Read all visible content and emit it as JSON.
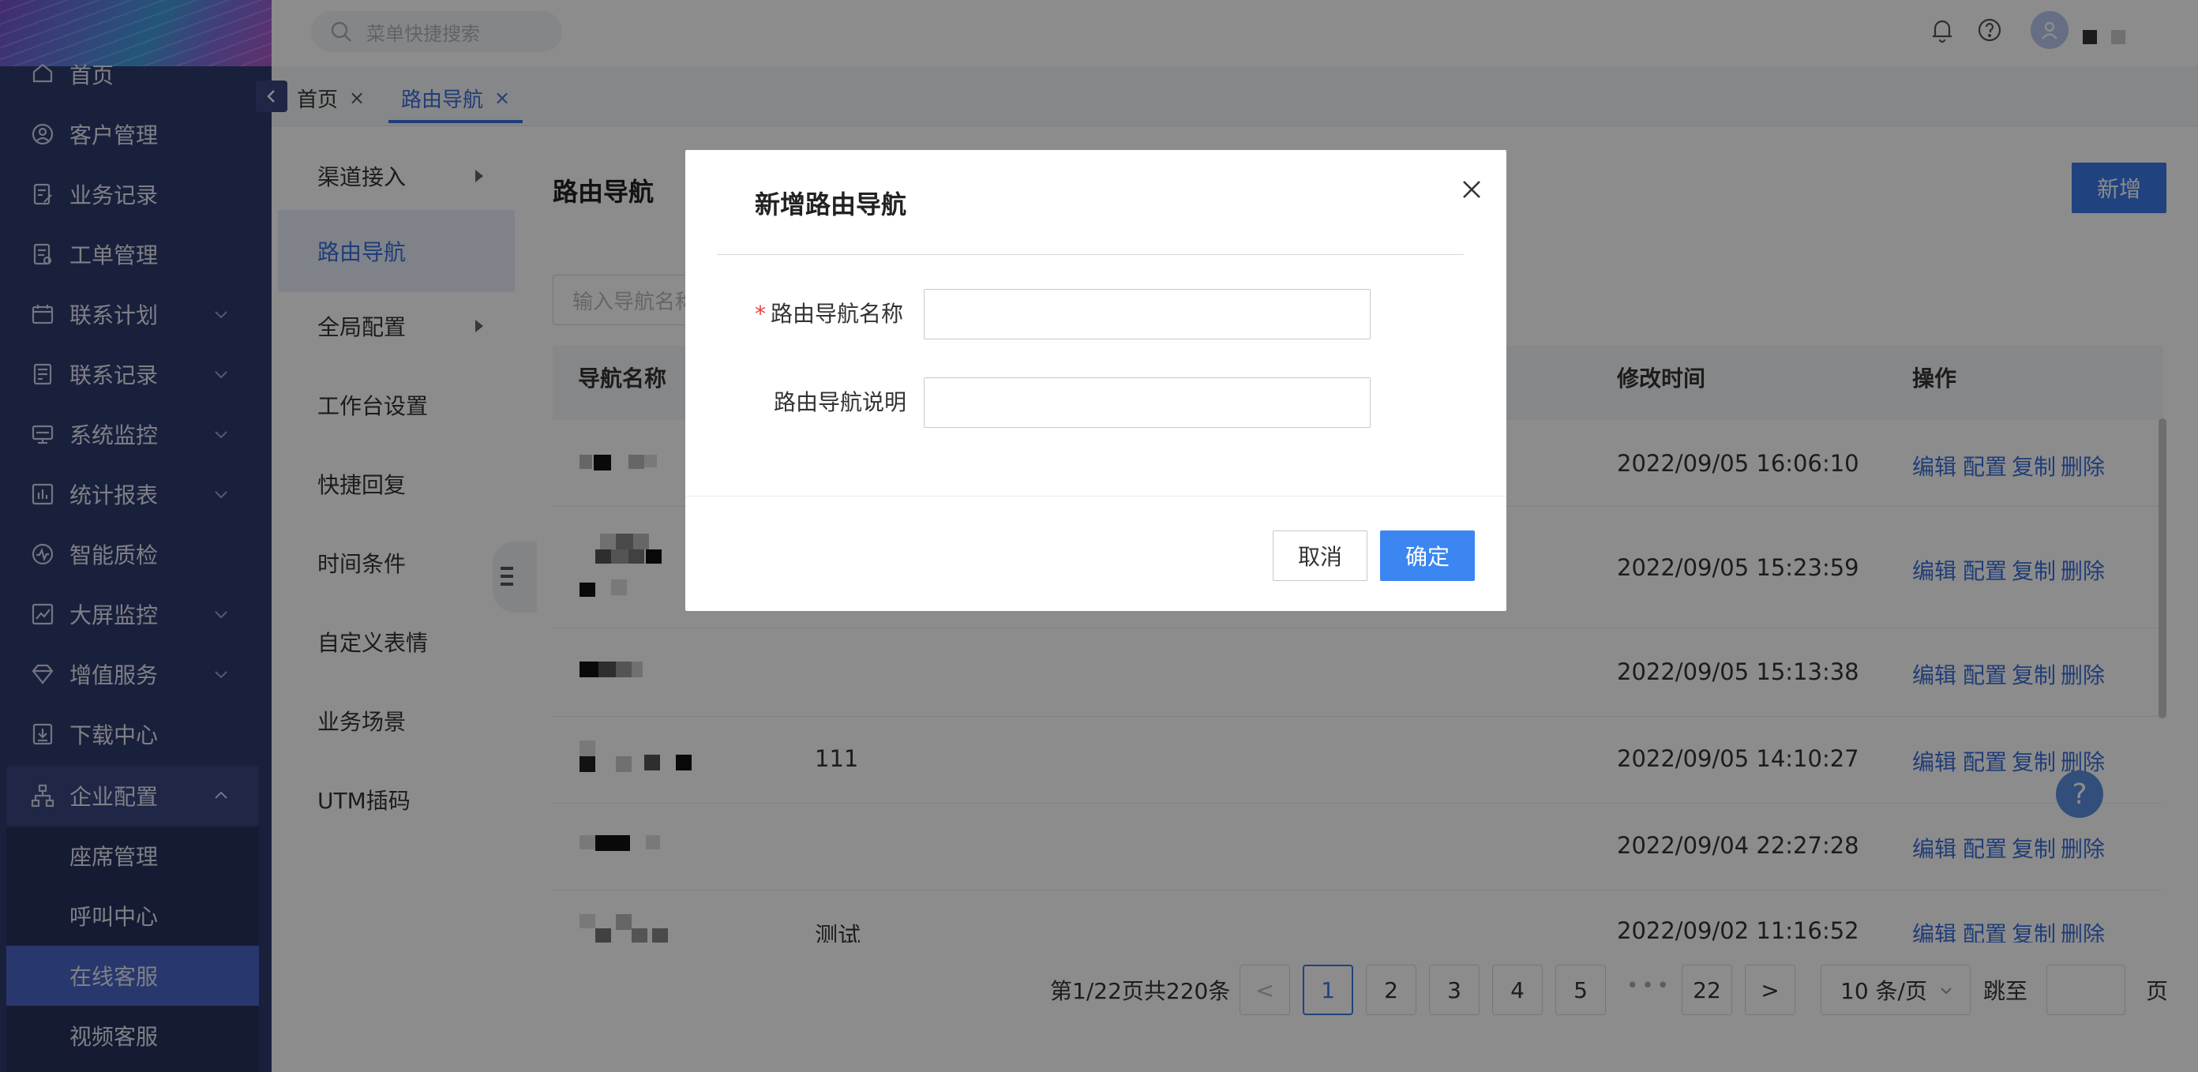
{
  "search": {
    "placeholder": "菜单快捷搜索"
  },
  "sidebar": {
    "items": [
      {
        "label": "首页",
        "icon": "home-icon"
      },
      {
        "label": "客户管理",
        "icon": "user-circle-icon"
      },
      {
        "label": "业务记录",
        "icon": "document-edit-icon"
      },
      {
        "label": "工单管理",
        "icon": "ticket-icon"
      },
      {
        "label": "联系计划",
        "icon": "calendar-icon"
      },
      {
        "label": "联系记录",
        "icon": "record-icon"
      },
      {
        "label": "系统监控",
        "icon": "monitor-icon"
      },
      {
        "label": "统计报表",
        "icon": "bar-chart-icon"
      },
      {
        "label": "智能质检",
        "icon": "quality-check-icon"
      },
      {
        "label": "大屏监控",
        "icon": "trend-chart-icon"
      },
      {
        "label": "增值服务",
        "icon": "diamond-icon"
      },
      {
        "label": "下载中心",
        "icon": "download-icon"
      },
      {
        "label": "企业配置",
        "icon": "org-chart-icon"
      }
    ],
    "subitems": [
      {
        "label": "座席管理"
      },
      {
        "label": "呼叫中心"
      },
      {
        "label": "在线客服"
      },
      {
        "label": "视频客服"
      }
    ]
  },
  "tabs": [
    {
      "label": "首页",
      "close": "×"
    },
    {
      "label": "路由导航",
      "close": "×"
    }
  ],
  "submenu": {
    "items": [
      {
        "label": "渠道接入"
      },
      {
        "label": "路由导航"
      },
      {
        "label": "全局配置"
      },
      {
        "label": "工作台设置"
      },
      {
        "label": "快捷回复"
      },
      {
        "label": "时间条件"
      },
      {
        "label": "自定义表情"
      },
      {
        "label": "业务场景"
      },
      {
        "label": "UTM插码"
      }
    ]
  },
  "main": {
    "title": "路由导航",
    "add_label": "新增",
    "filter_placeholder": "输入导航名称",
    "columns": {
      "name": "导航名称",
      "modified": "修改时间",
      "actions": "操作"
    },
    "actions": {
      "edit": "编辑",
      "config": "配置",
      "copy": "复制",
      "delete": "删除"
    },
    "rows": [
      {
        "desc": "",
        "time": "2022/09/05 16:06:10"
      },
      {
        "desc": "",
        "time": "2022/09/05 15:23:59"
      },
      {
        "desc": "",
        "time": "2022/09/05 15:13:38"
      },
      {
        "desc": "111",
        "time": "2022/09/05 14:10:27"
      },
      {
        "desc": "",
        "time": "2022/09/04 22:27:28"
      },
      {
        "desc": "测试",
        "time": "2022/09/02 11:16:52"
      }
    ]
  },
  "pagination": {
    "summary": "第1/22页共220条",
    "prev": "<",
    "pages": [
      "1",
      "2",
      "3",
      "4",
      "5"
    ],
    "dots": "•••",
    "last": "22",
    "next": ">",
    "page_size": "10 条/页",
    "jump_label": "跳至",
    "page_suffix": "页"
  },
  "help": {
    "label": "?"
  },
  "modal": {
    "title": "新增路由导航",
    "required_mark": "*",
    "name_label": "路由导航名称",
    "name_value": "",
    "desc_label": "路由导航说明",
    "desc_value": "",
    "cancel_label": "取消",
    "ok_label": "确定"
  },
  "colors": {
    "primary": "#3b78e7",
    "sidebar": "#2f3b6e",
    "required": "#e84040"
  }
}
